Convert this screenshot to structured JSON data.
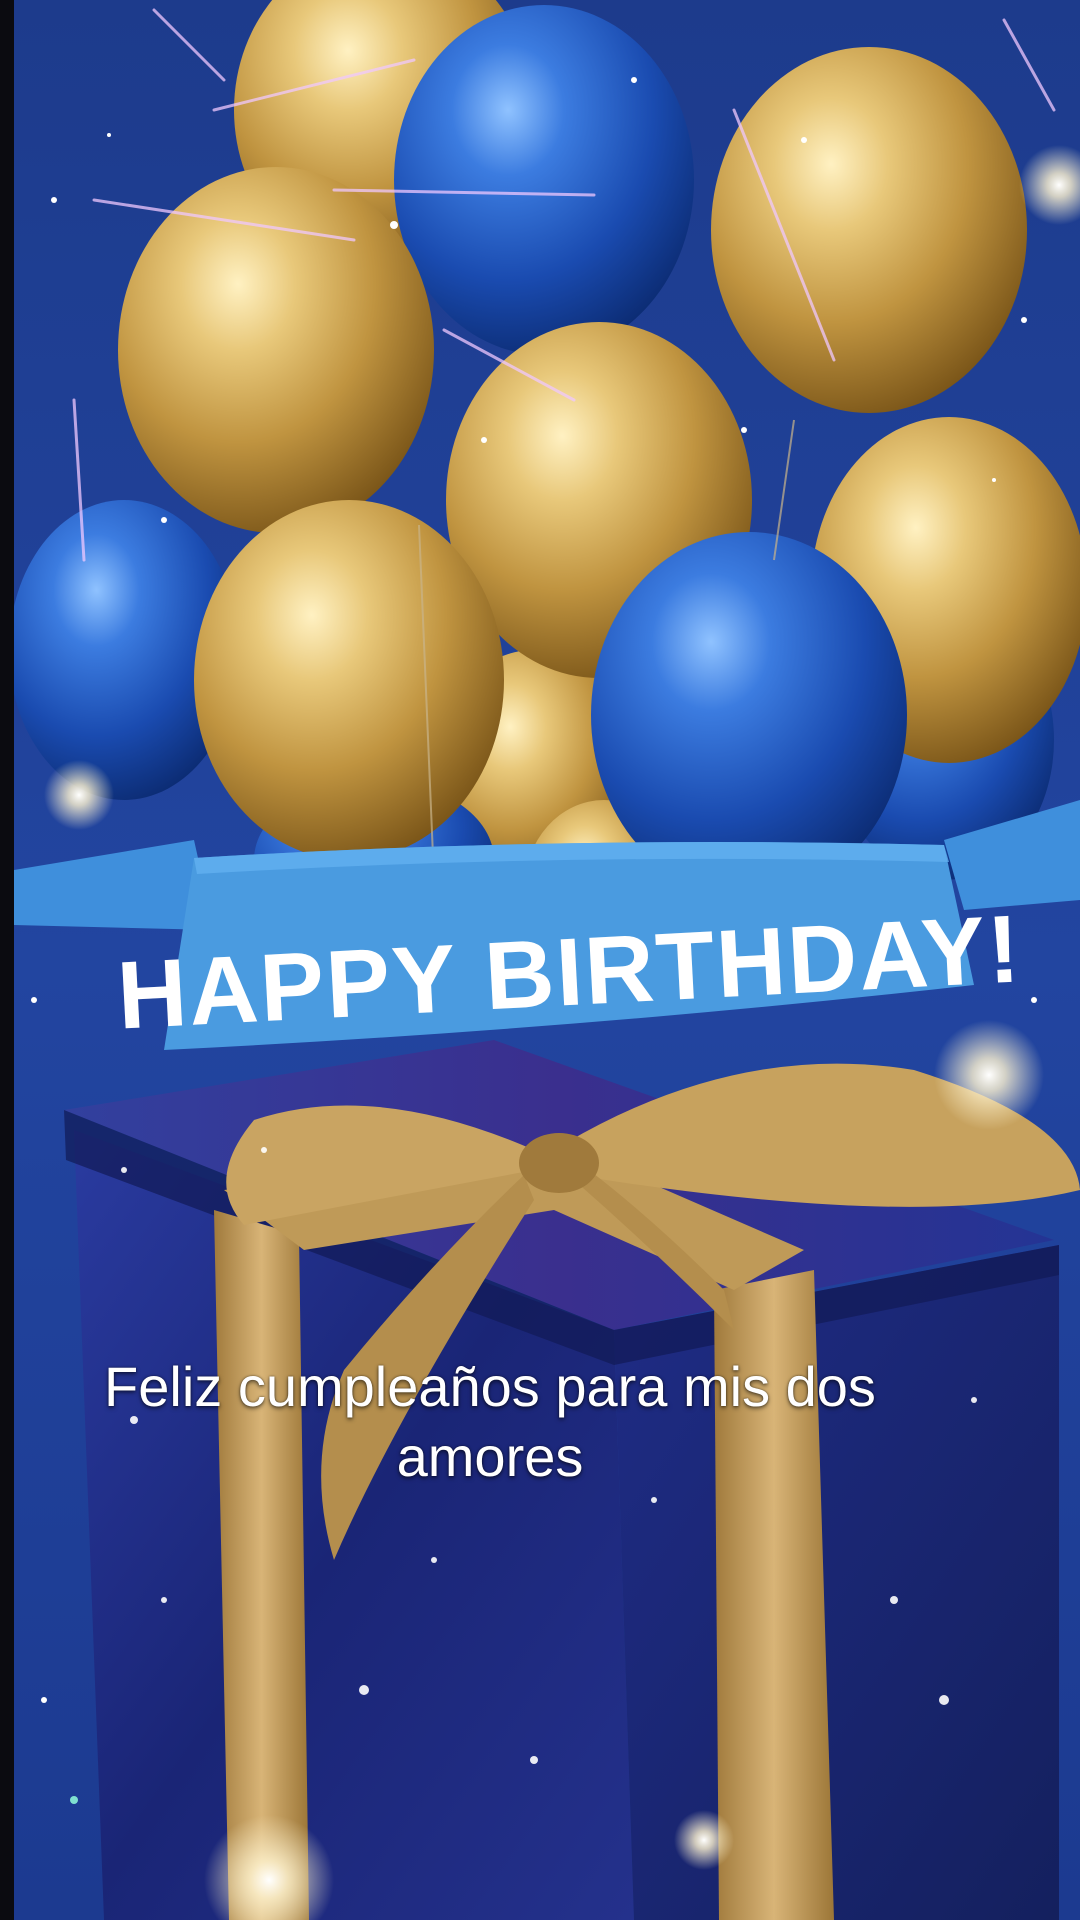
{
  "banner": {
    "text": "HAPPY BIRTHDAY!"
  },
  "caption": {
    "line1": "Feliz cumpleaños para mis dos",
    "line2": "amores"
  },
  "colors": {
    "background": "#1f3f94",
    "banner": "#4a9be0",
    "gold_balloon": "#c9a24a",
    "blue_balloon": "#1f4fb8",
    "gift_box": "#1d2a7a",
    "ribbon": "#c7a25e"
  }
}
